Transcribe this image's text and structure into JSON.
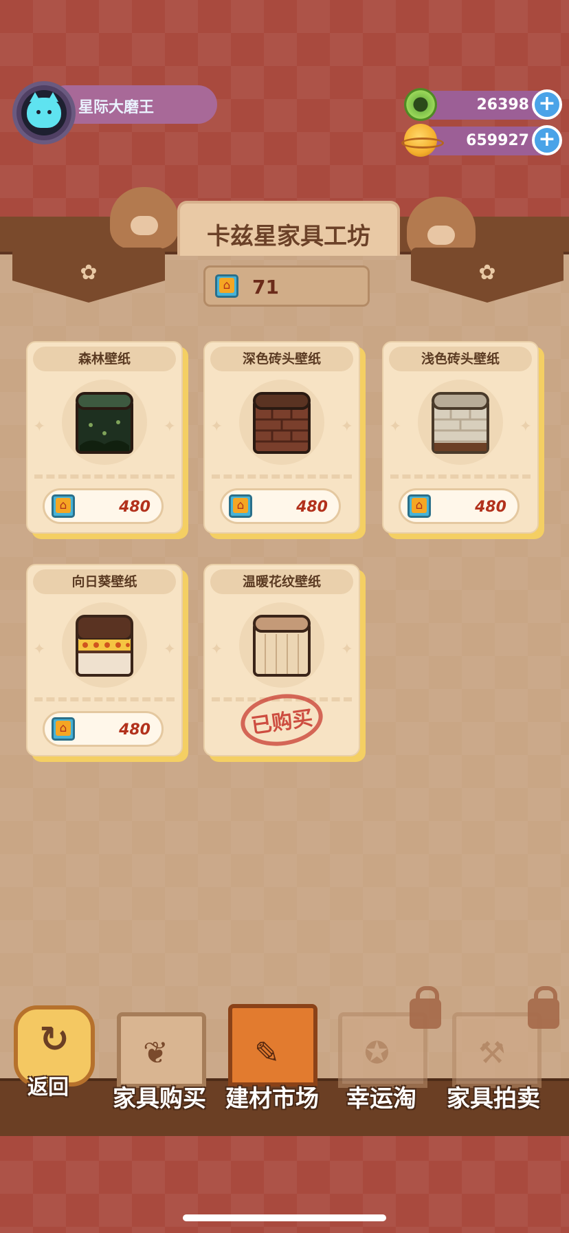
{
  "player": {
    "name": "星际大磨王",
    "avatar_icon": "cat-avatar-icon"
  },
  "currencies": [
    {
      "icon": "gem-icon",
      "value": "26398",
      "add_label": "+"
    },
    {
      "icon": "planet-coin-icon",
      "value": "659927",
      "add_label": "+"
    }
  ],
  "shop": {
    "title": "卡兹星家具工坊",
    "ticket_count": "71"
  },
  "items": [
    {
      "name": "森林壁纸",
      "price": "480",
      "purchased": false,
      "colors": {
        "roll": "#2e4a33",
        "pattern": "#1e3020"
      }
    },
    {
      "name": "深色砖头壁纸",
      "price": "480",
      "purchased": false,
      "colors": {
        "roll": "#6a3a2a",
        "pattern": "#8a4a32"
      }
    },
    {
      "name": "浅色砖头壁纸",
      "price": "480",
      "purchased": false,
      "colors": {
        "roll": "#b8ab97",
        "pattern": "#d8cfbd"
      }
    },
    {
      "name": "向日葵壁纸",
      "price": "480",
      "purchased": false,
      "colors": {
        "roll": "#5a3322",
        "pattern": "#efe1cf"
      }
    },
    {
      "name": "温暖花纹壁纸",
      "price": "",
      "purchased": true,
      "stamp": "已购买",
      "colors": {
        "roll": "#c49a78",
        "pattern": "#ecd6b4"
      }
    }
  ],
  "nav": {
    "back_label": "返回",
    "tabs": [
      {
        "label": "家具购买",
        "icon": "plant-pot-icon",
        "active": false,
        "locked": false
      },
      {
        "label": "建材市场",
        "icon": "paint-brush-icon",
        "active": true,
        "locked": false
      },
      {
        "label": "幸运淘",
        "icon": "star-badge-icon",
        "active": false,
        "locked": true
      },
      {
        "label": "家具拍卖",
        "icon": "auction-hammer-icon",
        "active": false,
        "locked": true
      }
    ]
  },
  "theme": {
    "accent": "#a94a3e",
    "price_color": "#b2311c"
  }
}
